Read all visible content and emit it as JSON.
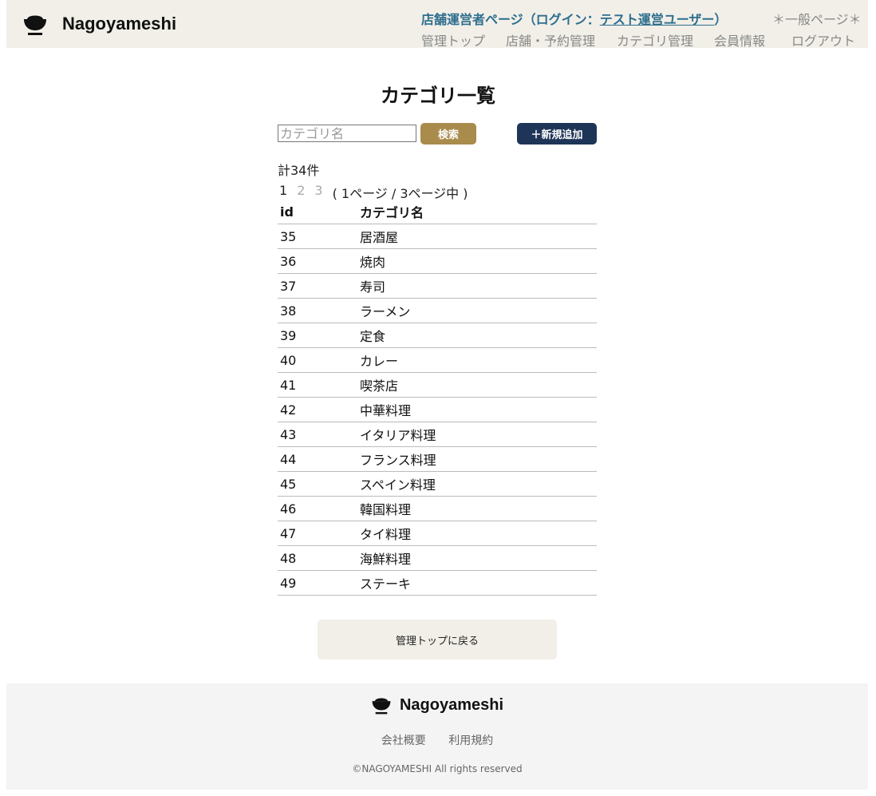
{
  "header": {
    "brand": "Nagoyameshi",
    "owner_prefix": "店舗運営者ページ（ログイン：",
    "owner_user": "テスト運営ユーザー",
    "owner_suffix": "）",
    "general_link": "＊一般ページ＊",
    "nav": [
      "管理トップ",
      "店舗・予約管理",
      "カテゴリ管理",
      "会員情報",
      "ログアウト"
    ]
  },
  "page": {
    "title": "カテゴリ一覧",
    "search_placeholder": "カテゴリ名",
    "search_value": "",
    "search_button": "検索",
    "add_button": "＋新規追加",
    "total": "計34件",
    "pagination": {
      "pages": [
        "1",
        "2",
        "3"
      ],
      "current": "1",
      "info": "( 1ページ / 3ページ中 )"
    },
    "table": {
      "headers": [
        "id",
        "カテゴリ名"
      ],
      "rows": [
        [
          "35",
          "居酒屋"
        ],
        [
          "36",
          "焼肉"
        ],
        [
          "37",
          "寿司"
        ],
        [
          "38",
          "ラーメン"
        ],
        [
          "39",
          "定食"
        ],
        [
          "40",
          "カレー"
        ],
        [
          "41",
          "喫茶店"
        ],
        [
          "42",
          "中華料理"
        ],
        [
          "43",
          "イタリア料理"
        ],
        [
          "44",
          "フランス料理"
        ],
        [
          "45",
          "スペイン料理"
        ],
        [
          "46",
          "韓国料理"
        ],
        [
          "47",
          "タイ料理"
        ],
        [
          "48",
          "海鮮料理"
        ],
        [
          "49",
          "ステーキ"
        ]
      ]
    },
    "back_button": "管理トップに戻る"
  },
  "footer": {
    "brand": "Nagoyameshi",
    "links": [
      "会社概要",
      "利用規約"
    ],
    "copyright": "©NAGOYAMESHI All rights reserved"
  },
  "icons": {
    "logo": "rice-bowl-icon"
  },
  "colors": {
    "header_bg": "#f1efe8",
    "owner_link": "#2e6e8e",
    "search_button": "#a98b4c",
    "add_button": "#1f3558",
    "footer_bg": "#f4f4f4"
  }
}
